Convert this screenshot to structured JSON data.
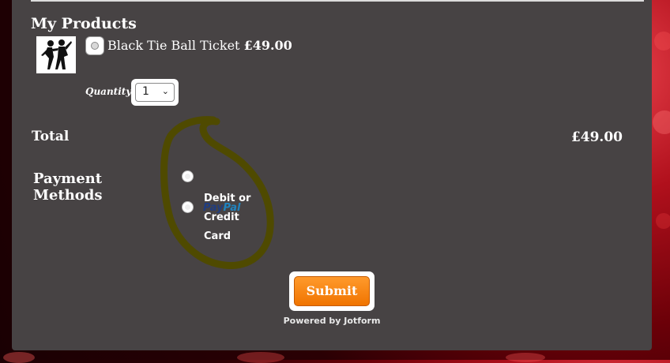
{
  "products_section": {
    "title": "My Products",
    "item": {
      "name": "Black Tie Ball Ticket",
      "price": "£49.00"
    },
    "quantity_label": "Quantity",
    "quantity_value": "1"
  },
  "total": {
    "label": "Total",
    "value": "£49.00"
  },
  "payment": {
    "label": "Payment Methods",
    "paypal_left": "Pay",
    "paypal_right": "Pal",
    "card_option_label": "Debit or Credit Card"
  },
  "submit_label": "Submit",
  "powered_by": "Powered by Jotform",
  "colors": {
    "card": "#474344",
    "submit": "#f07400",
    "annotation": "#4f4a00"
  }
}
